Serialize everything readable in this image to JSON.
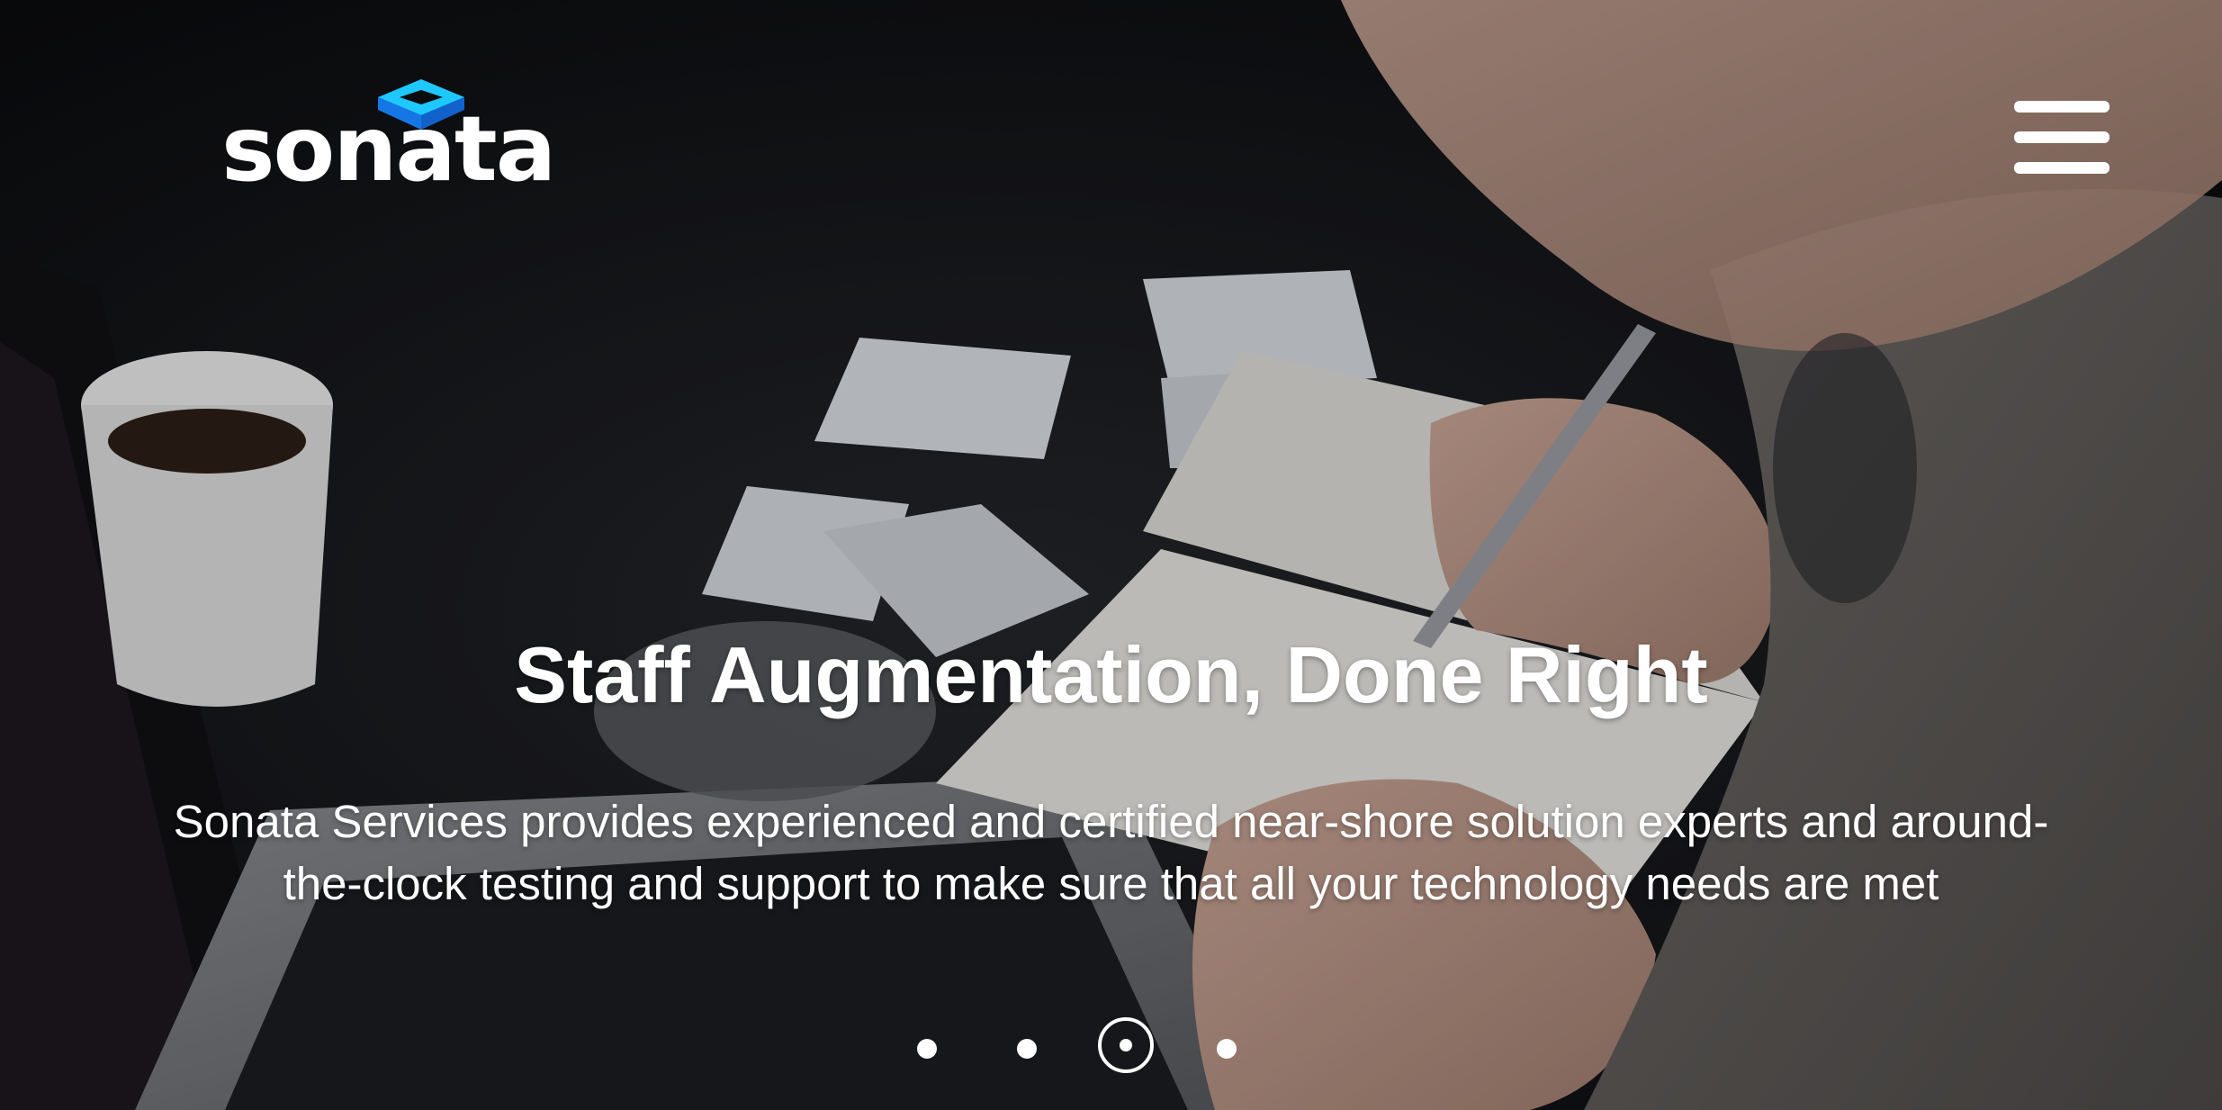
{
  "brand": {
    "logo_text": "sonata",
    "logo_color": "#ffffff",
    "mark_colors": [
      "#1ec8ff",
      "#1577e6"
    ]
  },
  "header": {
    "menu_icon": "hamburger-menu-icon"
  },
  "hero": {
    "headline": "Staff Augmentation, Done Right",
    "subtext": "Sonata Services provides experienced and certified near-shore solution experts and around-the-clock testing and support to make sure that all your technology needs are met"
  },
  "carousel": {
    "slide_count": 4,
    "active_index": 2
  }
}
